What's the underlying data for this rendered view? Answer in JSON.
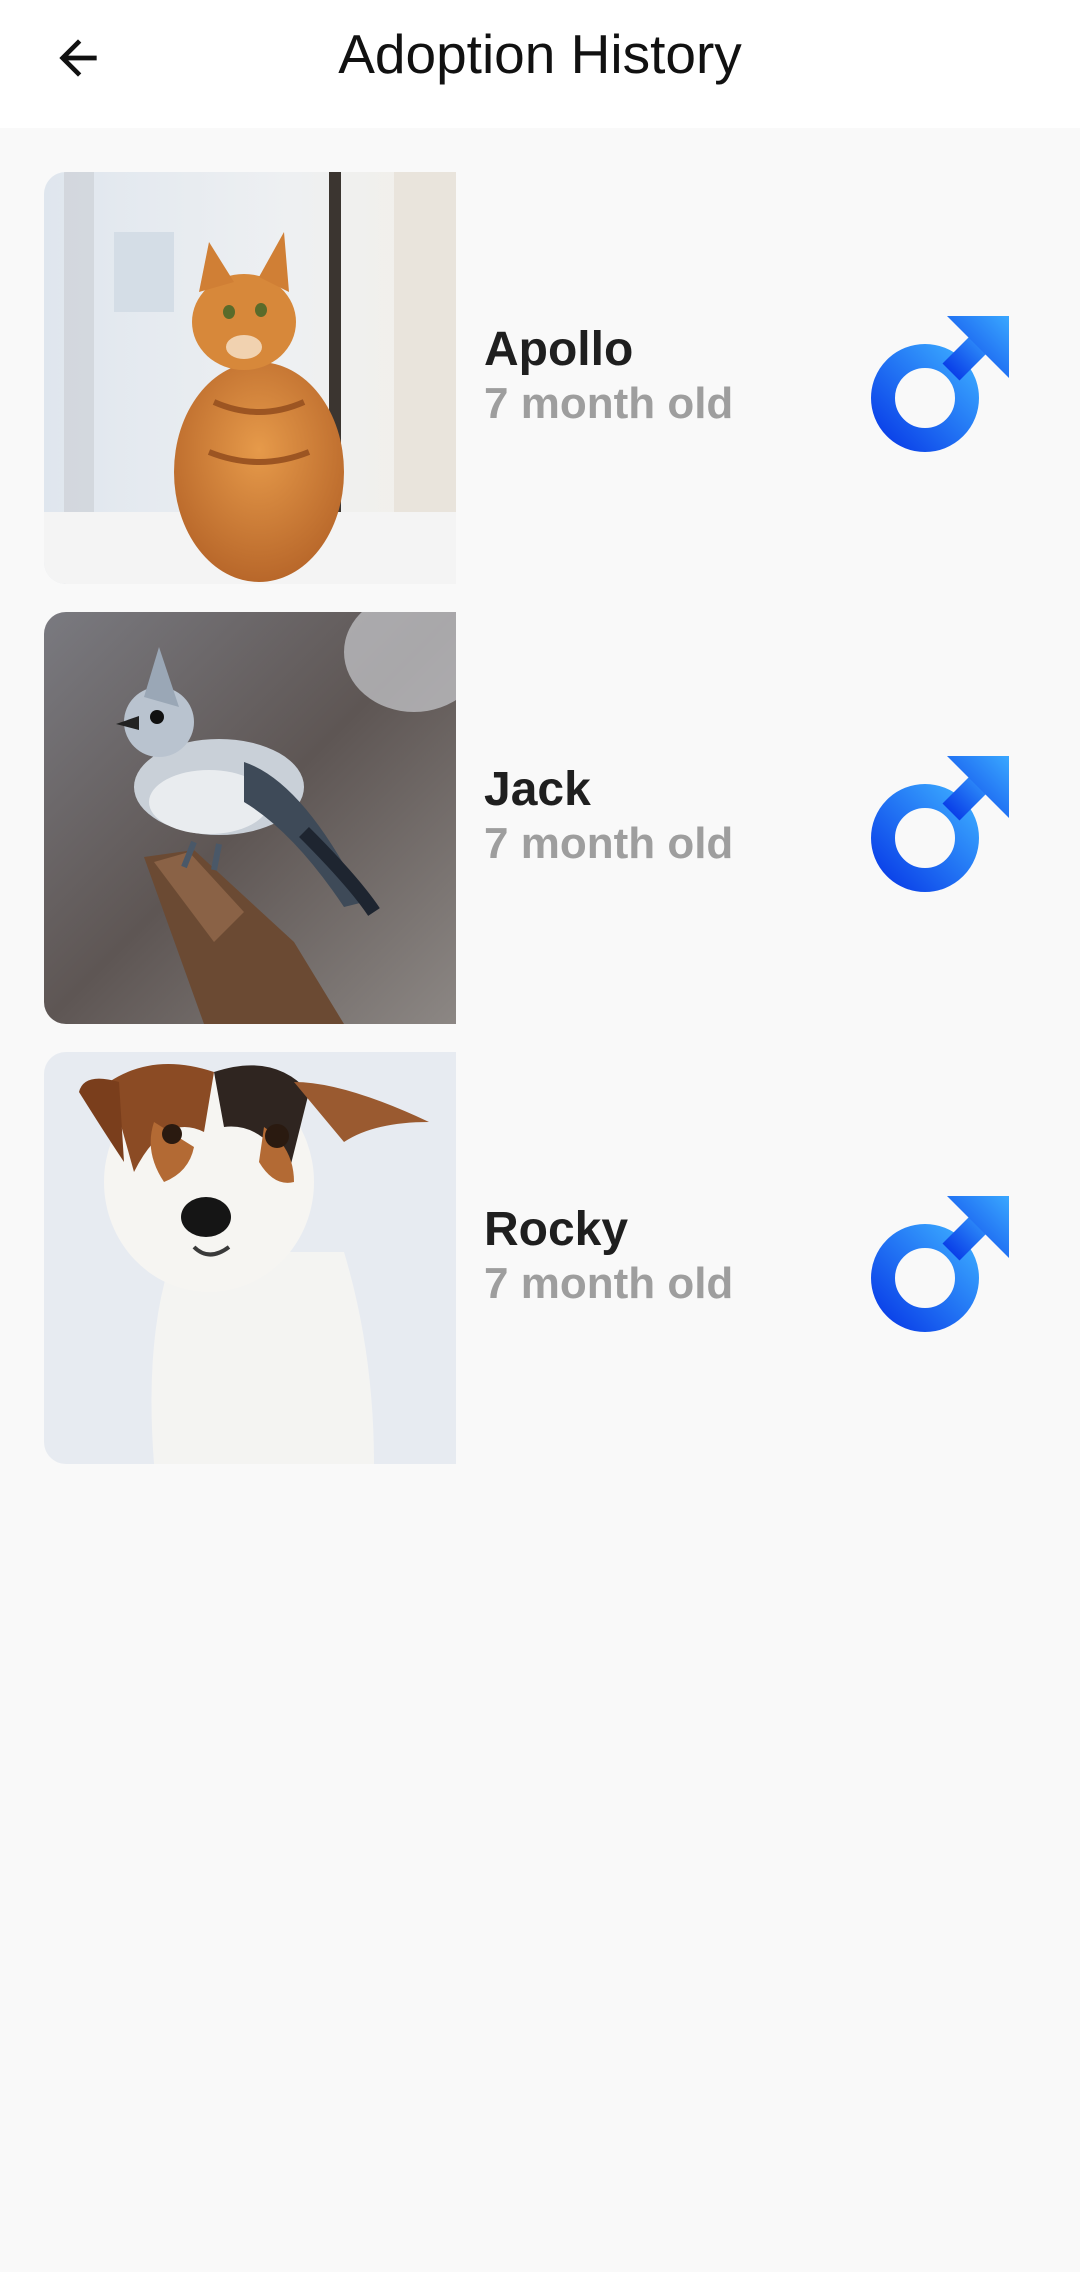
{
  "header": {
    "title": "Adoption History",
    "back_icon": "arrow-left-icon"
  },
  "colors": {
    "appbar_bg": "#ffffff",
    "page_bg": "#f9f9f9",
    "male_gradient_start": "#3aa8ff",
    "male_gradient_end": "#0a3fe8"
  },
  "pets": [
    {
      "name": "Apollo",
      "age": "7 month old",
      "gender_icon": "male-icon",
      "photo": "orange-cat-photo"
    },
    {
      "name": "Jack",
      "age": "7 month old",
      "gender_icon": "male-icon",
      "photo": "titmouse-bird-photo"
    },
    {
      "name": "Rocky",
      "age": "7 month old",
      "gender_icon": "male-icon",
      "photo": "jack-russell-dog-photo"
    }
  ]
}
